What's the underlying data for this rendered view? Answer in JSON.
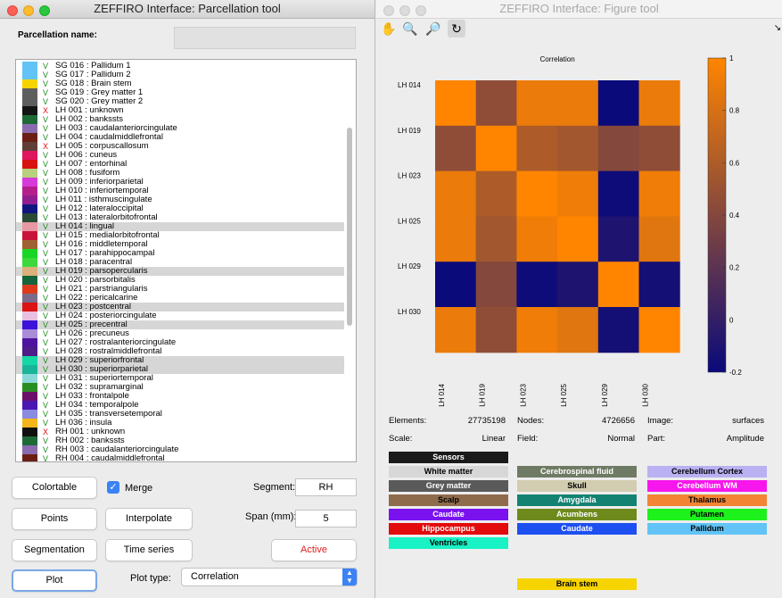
{
  "left": {
    "title": "ZEFFIRO Interface: Parcellation tool",
    "name_label": "Parcellation name:",
    "items": [
      {
        "check": "V",
        "label": "SG 016 : Pallidum 1",
        "color": "#62c3f6"
      },
      {
        "check": "V",
        "label": "SG 017 : Pallidum 2",
        "color": "#62c3f6"
      },
      {
        "check": "V",
        "label": "SG 018 : Brain stem",
        "color": "#f7d400"
      },
      {
        "check": "V",
        "label": "SG 019 : Grey matter 1",
        "color": "#5e5e5e"
      },
      {
        "check": "V",
        "label": "SG 020 : Grey matter 2",
        "color": "#5e5e5e"
      },
      {
        "check": "X",
        "label": "LH 001 : unknown",
        "color": "#141414"
      },
      {
        "check": "V",
        "label": "LH 002 : bankssts",
        "color": "#1d6a37"
      },
      {
        "check": "V",
        "label": "LH 003 : caudalanteriorcingulate",
        "color": "#8a6bb0"
      },
      {
        "check": "V",
        "label": "LH 004 : caudalmiddlefrontal",
        "color": "#6b1f14"
      },
      {
        "check": "X",
        "label": "LH 005 : corpuscallosum",
        "color": "#5f3f36"
      },
      {
        "check": "V",
        "label": "LH 006 : cuneus",
        "color": "#e01560"
      },
      {
        "check": "V",
        "label": "LH 007 : entorhinal",
        "color": "#d81111"
      },
      {
        "check": "V",
        "label": "LH 008 : fusiform",
        "color": "#b7d07d"
      },
      {
        "check": "V",
        "label": "LH 009 : inferiorparietal",
        "color": "#d63ad8"
      },
      {
        "check": "V",
        "label": "LH 010 : inferiortemporal",
        "color": "#b51f8c"
      },
      {
        "check": "V",
        "label": "LH 011 : isthmuscingulate",
        "color": "#921d91"
      },
      {
        "check": "V",
        "label": "LH 012 : lateraloccipital",
        "color": "#13157f"
      },
      {
        "check": "V",
        "label": "LH 013 : lateralorbitofrontal",
        "color": "#2a4b35"
      },
      {
        "check": "V",
        "label": "LH 014 : lingual",
        "color": "#e898a2"
      },
      {
        "check": "V",
        "label": "LH 015 : medialorbitofrontal",
        "color": "#c8143b"
      },
      {
        "check": "V",
        "label": "LH 016 : middletemporal",
        "color": "#a06232"
      },
      {
        "check": "V",
        "label": "LH 017 : parahippocampal",
        "color": "#17d624"
      },
      {
        "check": "V",
        "label": "LH 018 : paracentral",
        "color": "#3cd93c"
      },
      {
        "check": "V",
        "label": "LH 019 : parsopercularis",
        "color": "#dab17a"
      },
      {
        "check": "V",
        "label": "LH 020 : parsorbitalis",
        "color": "#14653b"
      },
      {
        "check": "V",
        "label": "LH 021 : parstriangularis",
        "color": "#dc3b1b"
      },
      {
        "check": "V",
        "label": "LH 022 : pericalcarine",
        "color": "#7a6b8a"
      },
      {
        "check": "V",
        "label": "LH 023 : postcentral",
        "color": "#d91412"
      },
      {
        "check": "V",
        "label": "LH 024 : posteriorcingulate",
        "color": "#e8bfe0"
      },
      {
        "check": "V",
        "label": "LH 025 : precentral",
        "color": "#3b13d8"
      },
      {
        "check": "V",
        "label": "LH 026 : precuneus",
        "color": "#a98bd8"
      },
      {
        "check": "V",
        "label": "LH 027 : rostralanteriorcingulate",
        "color": "#4f149e"
      },
      {
        "check": "V",
        "label": "LH 028 : rostralmiddlefrontal",
        "color": "#4e1d8a"
      },
      {
        "check": "V",
        "label": "LH 029 : superiorfrontal",
        "color": "#15d7a6"
      },
      {
        "check": "V",
        "label": "LH 030 : superiorparietal",
        "color": "#18b598"
      },
      {
        "check": "V",
        "label": "LH 031 : superiortemporal",
        "color": "#8cd7d9"
      },
      {
        "check": "V",
        "label": "LH 032 : supramarginal",
        "color": "#2a8f23"
      },
      {
        "check": "V",
        "label": "LH 033 : frontalpole",
        "color": "#6c0f6b"
      },
      {
        "check": "V",
        "label": "LH 034 : temporalpole",
        "color": "#4a18b0"
      },
      {
        "check": "V",
        "label": "LH 035 : transversetemporal",
        "color": "#8a8ae0"
      },
      {
        "check": "V",
        "label": "LH 036 : insula",
        "color": "#f3b51a"
      },
      {
        "check": "X",
        "label": "RH 001 : unknown",
        "color": "#101010"
      },
      {
        "check": "V",
        "label": "RH 002 : bankssts",
        "color": "#1d6a37"
      },
      {
        "check": "V",
        "label": "RH 003 : caudalanteriorcingulate",
        "color": "#8a6bb0"
      },
      {
        "check": "V",
        "label": "RH 004 : caudalmiddlefrontal",
        "color": "#6b1f14"
      }
    ],
    "selected_items": [
      "LH 014 : lingual",
      "LH 019 : parsopercularis",
      "LH 023 : postcentral",
      "LH 025 : precentral",
      "LH 029 : superiorfrontal",
      "LH 030 : superiorparietal"
    ],
    "buttons": {
      "colortable": "Colortable",
      "merge": "Merge",
      "points": "Points",
      "interpolate": "Interpolate",
      "segmentation": "Segmentation",
      "time_series": "Time series",
      "active": "Active",
      "plot": "Plot"
    },
    "segment_label": "Segment:",
    "segment_value": "RH",
    "span_label": "Span (mm):",
    "span_value": "5",
    "plot_type_label": "Plot type:",
    "plot_type_value": "Correlation"
  },
  "right": {
    "title": "ZEFFIRO Interface: Figure tool",
    "tools": [
      "pan-icon",
      "zoom-in-icon",
      "zoom-out-icon",
      "rotate-icon"
    ],
    "info": {
      "elements_label": "Elements:",
      "elements_value": "27735198",
      "nodes_label": "Nodes:",
      "nodes_value": "4726656",
      "image_label": "Image:",
      "image_value": "surfaces",
      "scale_label": "Scale:",
      "scale_value": "Linear",
      "field_label": "Field:",
      "field_value": "Normal",
      "part_label": "Part:",
      "part_value": "Amplitude"
    },
    "legend": [
      {
        "label": "Sensors",
        "color": "#1a1a1a",
        "text": "#ffffff"
      },
      {
        "label": "White matter",
        "color": "#d7d7d7",
        "text": "#000000"
      },
      {
        "label": "Grey matter",
        "color": "#5a5a5a",
        "text": "#ffffff"
      },
      {
        "label": "Scalp",
        "color": "#8e6b4b",
        "text": "#000000"
      },
      {
        "label": "Caudate",
        "color": "#7a12f0",
        "text": "#ffffff"
      },
      {
        "label": "Hippocampus",
        "color": "#e20c0c",
        "text": "#ffffff"
      },
      {
        "label": "Ventricles",
        "color": "#19f2c5",
        "text": "#000000"
      },
      {
        "label": "Cerebrospinal fluid",
        "color": "#6f7a64",
        "text": "#ffffff"
      },
      {
        "label": "Skull",
        "color": "#d2cdb0",
        "text": "#000000"
      },
      {
        "label": "Amygdala",
        "color": "#138272",
        "text": "#ffffff"
      },
      {
        "label": "Acumbens",
        "color": "#6e8a1d",
        "text": "#ffffff"
      },
      {
        "label": "Caudate",
        "color": "#1e4ff1",
        "text": "#ffffff"
      },
      {
        "label": "Brain stem",
        "color": "#f7d400",
        "text": "#000000"
      },
      {
        "label": "Cerebellum Cortex",
        "color": "#b9b1f2",
        "text": "#000000"
      },
      {
        "label": "Cerebellum WM",
        "color": "#f716ec",
        "text": "#ffffff"
      },
      {
        "label": "Thalamus",
        "color": "#f28433",
        "text": "#000000"
      },
      {
        "label": "Putamen",
        "color": "#1df21c",
        "text": "#000000"
      },
      {
        "label": "Pallidum",
        "color": "#62c3f6",
        "text": "#000000"
      }
    ]
  },
  "chart_data": {
    "type": "heatmap",
    "title": "Correlation",
    "x": [
      "LH 014",
      "LH 019",
      "LH 023",
      "LH 025",
      "LH 029",
      "LH 030"
    ],
    "y": [
      "LH 014",
      "LH 019",
      "LH 023",
      "LH 025",
      "LH 029",
      "LH 030"
    ],
    "values": [
      [
        1.0,
        0.45,
        0.9,
        0.9,
        -0.2,
        0.9
      ],
      [
        0.45,
        1.0,
        0.6,
        0.55,
        0.4,
        0.45
      ],
      [
        0.9,
        0.6,
        1.0,
        0.92,
        -0.18,
        0.92
      ],
      [
        0.9,
        0.55,
        0.92,
        1.0,
        -0.1,
        0.85
      ],
      [
        -0.2,
        0.4,
        -0.18,
        -0.1,
        1.0,
        -0.15
      ],
      [
        0.9,
        0.45,
        0.92,
        0.85,
        -0.15,
        1.0
      ]
    ],
    "colorbar_ticks": [
      1,
      0.8,
      0.6,
      0.4,
      0.2,
      0,
      -0.2
    ],
    "zlim": [
      -0.2,
      1
    ],
    "colormap_low": "#0a0a7a",
    "colormap_high": "#ff8500"
  }
}
